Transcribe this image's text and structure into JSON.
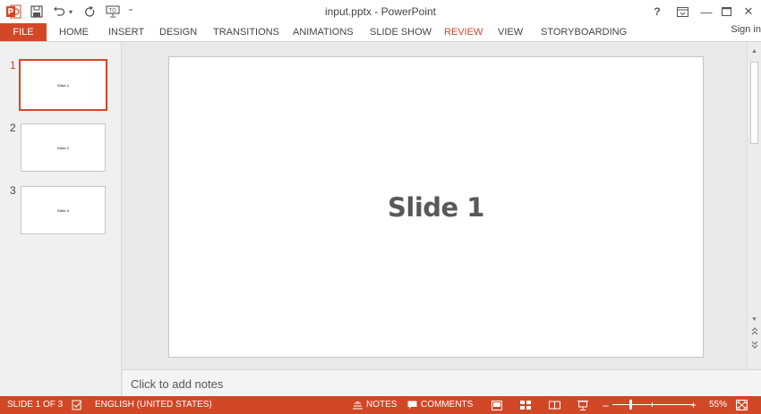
{
  "window": {
    "title": "input.pptx - PowerPoint",
    "help": "?",
    "min": "—",
    "close": "✕"
  },
  "qat": {
    "undo_dropdown": "▾",
    "customize": "⁼"
  },
  "ribbon": {
    "file": "FILE",
    "tabs": [
      "HOME",
      "INSERT",
      "DESIGN",
      "TRANSITIONS",
      "ANIMATIONS",
      "SLIDE SHOW",
      "REVIEW",
      "VIEW",
      "STORYBOARDING"
    ],
    "active_tab": "REVIEW",
    "signin": "Sign in"
  },
  "thumbnails": [
    {
      "number": "1",
      "text": "Slide 1"
    },
    {
      "number": "2",
      "text": "Slide 2"
    },
    {
      "number": "3",
      "text": "Slide 3"
    }
  ],
  "slide": {
    "title": "Slide 1"
  },
  "notes": {
    "placeholder": "Click to add notes"
  },
  "status": {
    "slide_indicator": "SLIDE 1 OF 3",
    "language": "ENGLISH (UNITED STATES)",
    "notes": "NOTES",
    "comments": "COMMENTS",
    "zoom_out": "–",
    "zoom_in": "+",
    "zoom": "55%",
    "zoom_fraction": 0.55
  },
  "colors": {
    "accent": "#d24726",
    "slide_text": "#595959"
  }
}
